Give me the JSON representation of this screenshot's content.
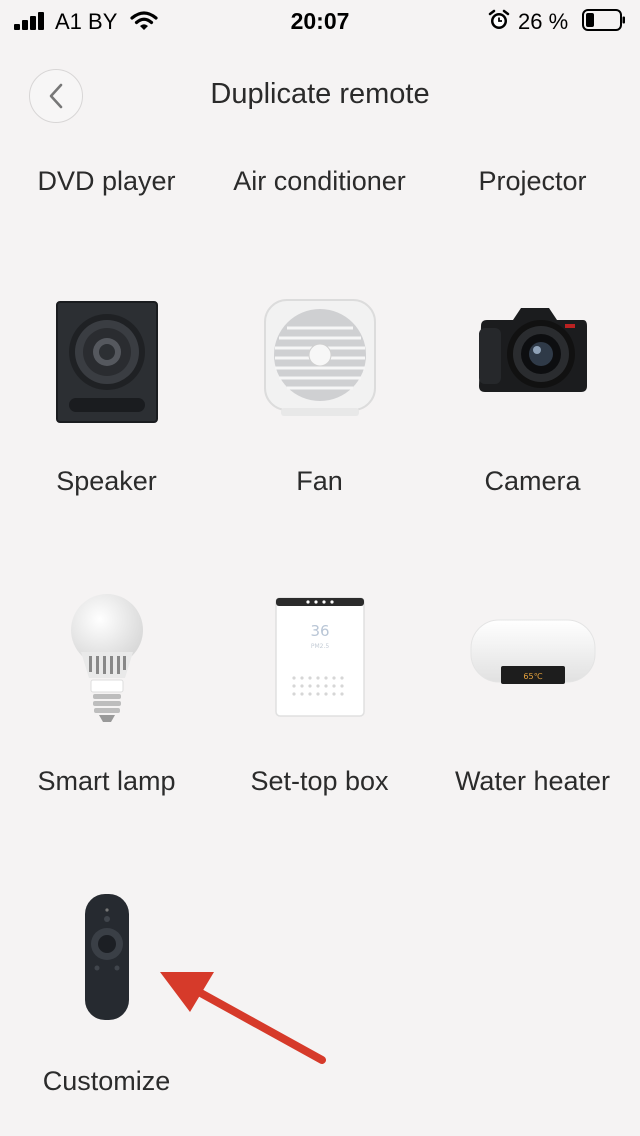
{
  "status_bar": {
    "carrier": "A1 BY",
    "time": "20:07",
    "battery_percent": "26 %",
    "icons": [
      "signal-icon",
      "wifi-icon",
      "alarm-icon",
      "battery-icon"
    ]
  },
  "header": {
    "title": "Duplicate remote",
    "back_icon": "chevron-left-icon"
  },
  "devices": [
    {
      "label": "DVD player"
    },
    {
      "label": "Air conditioner"
    },
    {
      "label": "Projector"
    },
    {
      "label": "Speaker",
      "icon": "speaker-icon"
    },
    {
      "label": "Fan",
      "icon": "fan-icon"
    },
    {
      "label": "Camera",
      "icon": "camera-icon"
    },
    {
      "label": "Smart lamp",
      "icon": "lamp-icon"
    },
    {
      "label": "Set-top box",
      "icon": "set-top-box-icon",
      "display_text": "36",
      "display_subtext": "PM2.5"
    },
    {
      "label": "Water heater",
      "icon": "water-heater-icon",
      "display_text": "65℃"
    },
    {
      "label": "Customize",
      "icon": "remote-control-icon"
    }
  ],
  "colors": {
    "background": "#f5f3f3",
    "annotation_arrow": "#d63a2a"
  }
}
